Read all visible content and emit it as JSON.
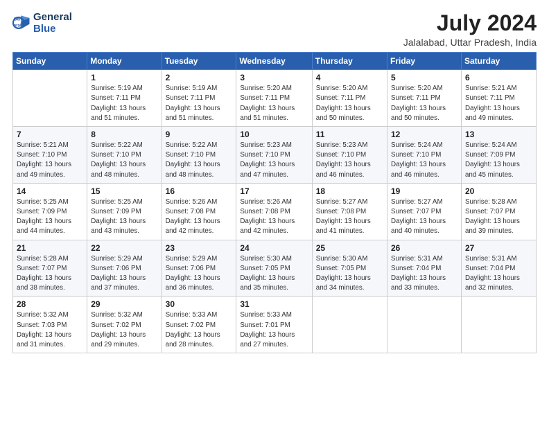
{
  "logo": {
    "text_line1": "General",
    "text_line2": "Blue"
  },
  "title": {
    "month_year": "July 2024",
    "location": "Jalalabad, Uttar Pradesh, India"
  },
  "days_of_week": [
    "Sunday",
    "Monday",
    "Tuesday",
    "Wednesday",
    "Thursday",
    "Friday",
    "Saturday"
  ],
  "weeks": [
    [
      {
        "day": "",
        "info": ""
      },
      {
        "day": "1",
        "info": "Sunrise: 5:19 AM\nSunset: 7:11 PM\nDaylight: 13 hours\nand 51 minutes."
      },
      {
        "day": "2",
        "info": "Sunrise: 5:19 AM\nSunset: 7:11 PM\nDaylight: 13 hours\nand 51 minutes."
      },
      {
        "day": "3",
        "info": "Sunrise: 5:20 AM\nSunset: 7:11 PM\nDaylight: 13 hours\nand 51 minutes."
      },
      {
        "day": "4",
        "info": "Sunrise: 5:20 AM\nSunset: 7:11 PM\nDaylight: 13 hours\nand 50 minutes."
      },
      {
        "day": "5",
        "info": "Sunrise: 5:20 AM\nSunset: 7:11 PM\nDaylight: 13 hours\nand 50 minutes."
      },
      {
        "day": "6",
        "info": "Sunrise: 5:21 AM\nSunset: 7:11 PM\nDaylight: 13 hours\nand 49 minutes."
      }
    ],
    [
      {
        "day": "7",
        "info": "Sunrise: 5:21 AM\nSunset: 7:10 PM\nDaylight: 13 hours\nand 49 minutes."
      },
      {
        "day": "8",
        "info": "Sunrise: 5:22 AM\nSunset: 7:10 PM\nDaylight: 13 hours\nand 48 minutes."
      },
      {
        "day": "9",
        "info": "Sunrise: 5:22 AM\nSunset: 7:10 PM\nDaylight: 13 hours\nand 48 minutes."
      },
      {
        "day": "10",
        "info": "Sunrise: 5:23 AM\nSunset: 7:10 PM\nDaylight: 13 hours\nand 47 minutes."
      },
      {
        "day": "11",
        "info": "Sunrise: 5:23 AM\nSunset: 7:10 PM\nDaylight: 13 hours\nand 46 minutes."
      },
      {
        "day": "12",
        "info": "Sunrise: 5:24 AM\nSunset: 7:10 PM\nDaylight: 13 hours\nand 46 minutes."
      },
      {
        "day": "13",
        "info": "Sunrise: 5:24 AM\nSunset: 7:09 PM\nDaylight: 13 hours\nand 45 minutes."
      }
    ],
    [
      {
        "day": "14",
        "info": "Sunrise: 5:25 AM\nSunset: 7:09 PM\nDaylight: 13 hours\nand 44 minutes."
      },
      {
        "day": "15",
        "info": "Sunrise: 5:25 AM\nSunset: 7:09 PM\nDaylight: 13 hours\nand 43 minutes."
      },
      {
        "day": "16",
        "info": "Sunrise: 5:26 AM\nSunset: 7:08 PM\nDaylight: 13 hours\nand 42 minutes."
      },
      {
        "day": "17",
        "info": "Sunrise: 5:26 AM\nSunset: 7:08 PM\nDaylight: 13 hours\nand 42 minutes."
      },
      {
        "day": "18",
        "info": "Sunrise: 5:27 AM\nSunset: 7:08 PM\nDaylight: 13 hours\nand 41 minutes."
      },
      {
        "day": "19",
        "info": "Sunrise: 5:27 AM\nSunset: 7:07 PM\nDaylight: 13 hours\nand 40 minutes."
      },
      {
        "day": "20",
        "info": "Sunrise: 5:28 AM\nSunset: 7:07 PM\nDaylight: 13 hours\nand 39 minutes."
      }
    ],
    [
      {
        "day": "21",
        "info": "Sunrise: 5:28 AM\nSunset: 7:07 PM\nDaylight: 13 hours\nand 38 minutes."
      },
      {
        "day": "22",
        "info": "Sunrise: 5:29 AM\nSunset: 7:06 PM\nDaylight: 13 hours\nand 37 minutes."
      },
      {
        "day": "23",
        "info": "Sunrise: 5:29 AM\nSunset: 7:06 PM\nDaylight: 13 hours\nand 36 minutes."
      },
      {
        "day": "24",
        "info": "Sunrise: 5:30 AM\nSunset: 7:05 PM\nDaylight: 13 hours\nand 35 minutes."
      },
      {
        "day": "25",
        "info": "Sunrise: 5:30 AM\nSunset: 7:05 PM\nDaylight: 13 hours\nand 34 minutes."
      },
      {
        "day": "26",
        "info": "Sunrise: 5:31 AM\nSunset: 7:04 PM\nDaylight: 13 hours\nand 33 minutes."
      },
      {
        "day": "27",
        "info": "Sunrise: 5:31 AM\nSunset: 7:04 PM\nDaylight: 13 hours\nand 32 minutes."
      }
    ],
    [
      {
        "day": "28",
        "info": "Sunrise: 5:32 AM\nSunset: 7:03 PM\nDaylight: 13 hours\nand 31 minutes."
      },
      {
        "day": "29",
        "info": "Sunrise: 5:32 AM\nSunset: 7:02 PM\nDaylight: 13 hours\nand 29 minutes."
      },
      {
        "day": "30",
        "info": "Sunrise: 5:33 AM\nSunset: 7:02 PM\nDaylight: 13 hours\nand 28 minutes."
      },
      {
        "day": "31",
        "info": "Sunrise: 5:33 AM\nSunset: 7:01 PM\nDaylight: 13 hours\nand 27 minutes."
      },
      {
        "day": "",
        "info": ""
      },
      {
        "day": "",
        "info": ""
      },
      {
        "day": "",
        "info": ""
      }
    ]
  ]
}
